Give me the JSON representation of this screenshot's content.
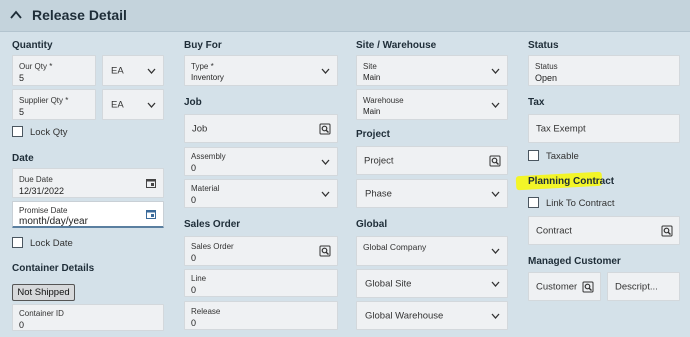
{
  "header": {
    "title": "Release Detail"
  },
  "col1": {
    "quantity_heading": "Quantity",
    "our_qty": {
      "label": "Our Qty *",
      "value": "5"
    },
    "our_uom": "EA",
    "supplier_qty": {
      "label": "Supplier Qty *",
      "value": "5"
    },
    "supplier_uom": "EA",
    "lock_qty": "Lock Qty",
    "date_heading": "Date",
    "due_date": {
      "label": "Due Date",
      "value": "12/31/2022"
    },
    "promise_date": {
      "label": "Promise Date",
      "value": "month/day/year"
    },
    "lock_date": "Lock Date",
    "container_heading": "Container Details",
    "not_shipped": "Not Shipped",
    "container_id": {
      "label": "Container ID",
      "value": "0"
    }
  },
  "col2": {
    "buy_for_heading": "Buy For",
    "type": {
      "label": "Type *",
      "value": "Inventory"
    },
    "job_heading": "Job",
    "job_placeholder": "Job",
    "assembly": {
      "label": "Assembly",
      "value": "0"
    },
    "material": {
      "label": "Material",
      "value": "0"
    },
    "sales_order_heading": "Sales Order",
    "sales_order": {
      "label": "Sales Order",
      "value": "0"
    },
    "line": {
      "label": "Line",
      "value": "0"
    },
    "release": {
      "label": "Release",
      "value": "0"
    }
  },
  "col3": {
    "site_heading": "Site / Warehouse",
    "site": {
      "label": "Site",
      "value": "Main"
    },
    "warehouse": {
      "label": "Warehouse",
      "value": "Main"
    },
    "project_heading": "Project",
    "project_placeholder": "Project",
    "phase_placeholder": "Phase",
    "global_heading": "Global",
    "global_company": "Global Company",
    "global_site": "Global Site",
    "global_warehouse": "Global Warehouse"
  },
  "col4": {
    "status_heading": "Status",
    "status": {
      "label": "Status",
      "value": "Open"
    },
    "tax_heading": "Tax",
    "tax_exempt": "Tax Exempt",
    "taxable": "Taxable",
    "planning_heading": "Planning Contract",
    "link_to_contract": "Link To Contract",
    "contract": "Contract",
    "managed_heading": "Managed Customer",
    "customer": "Customer",
    "description": "Descript..."
  },
  "colors": {
    "background": "#d4e1e9",
    "highlight": "#f4f51d",
    "focus_border": "#5a7fa0"
  }
}
